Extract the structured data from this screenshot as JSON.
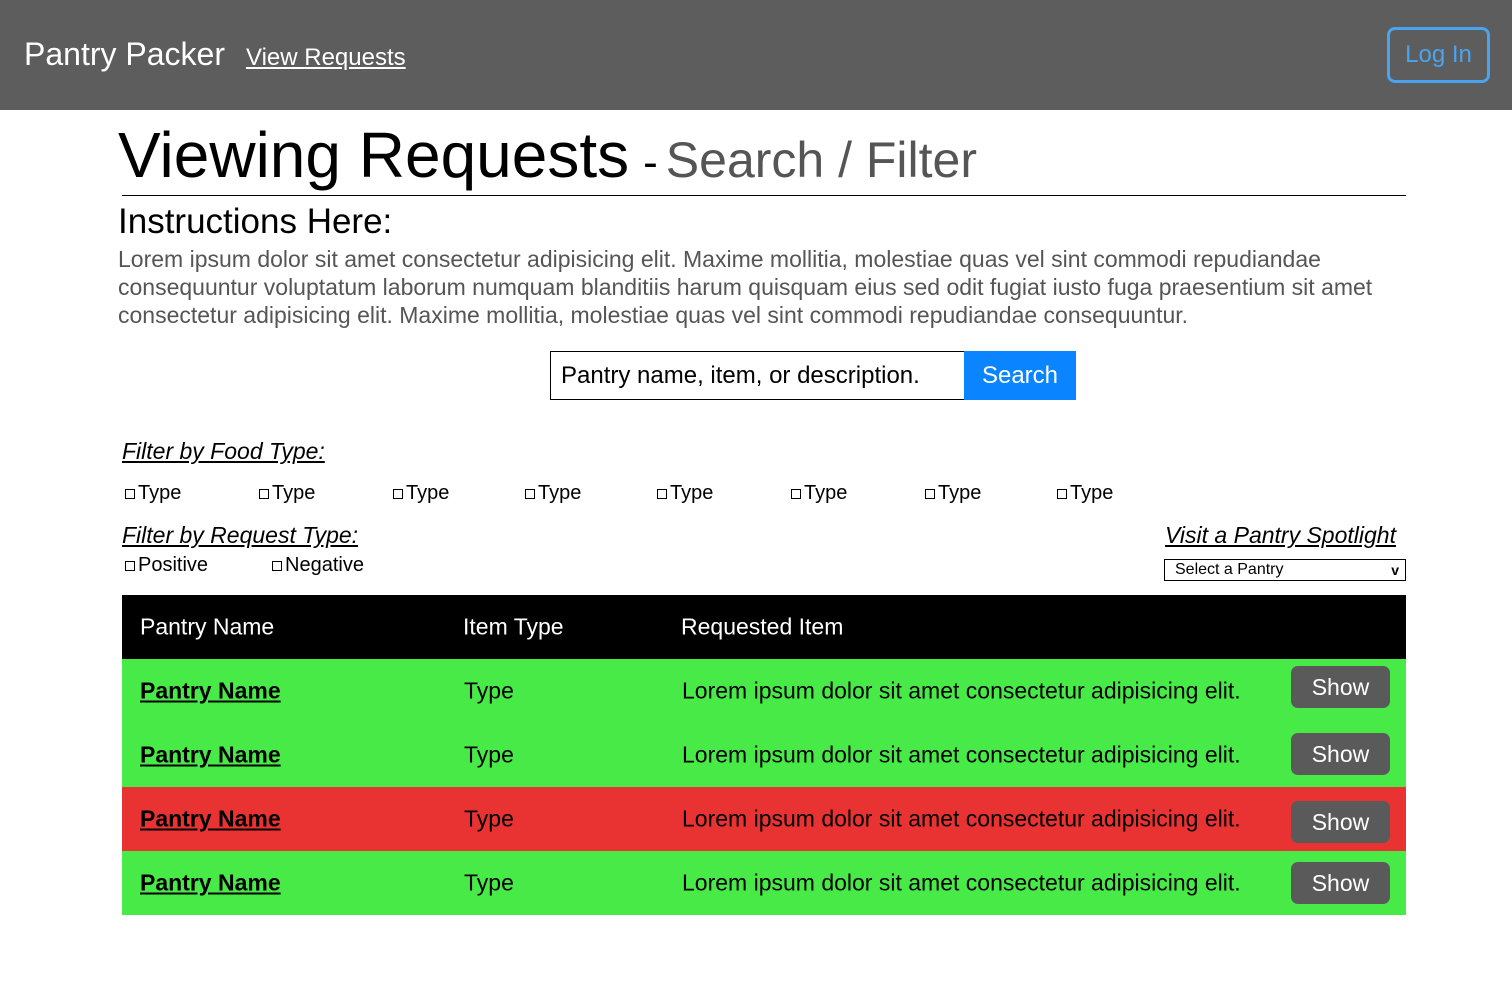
{
  "navbar": {
    "brand": "Pantry Packer",
    "view_requests": "View Requests",
    "login": "Log In",
    "login_color": "#4aa3ef"
  },
  "header": {
    "title": "Viewing Requests",
    "separator": "-",
    "subtitle": "Search / Filter"
  },
  "instructions": {
    "heading": "Instructions Here:",
    "body": "Lorem ipsum dolor sit amet consectetur adipisicing elit. Maxime mollitia, molestiae quas vel sint commodi repudiandae consequuntur voluptatum laborum numquam blanditiis harum quisquam eius sed odit fugiat iusto fuga praesentium sit amet consectetur adipisicing elit. Maxime mollitia, molestiae quas vel sint commodi repudiandae consequuntur."
  },
  "search": {
    "placeholder": "Pantry name, item, or description.",
    "button": "Search",
    "button_color": "#0a84ff"
  },
  "filters": {
    "food_type_label": "Filter by Food Type:",
    "food_types": [
      "Type",
      "Type",
      "Type",
      "Type",
      "Type",
      "Type",
      "Type",
      "Type"
    ],
    "request_type_label": "Filter by Request Type:",
    "request_types": [
      "Positive",
      "Negative"
    ]
  },
  "spotlight": {
    "label": "Visit a Pantry Spotlight",
    "selected": "Select a Pantry",
    "chevron": "v"
  },
  "table": {
    "columns": [
      "Pantry Name",
      "Item Type",
      "Requested Item"
    ],
    "rows": [
      {
        "pantry": "Pantry Name",
        "type": "Type",
        "item": "Lorem ipsum dolor sit amet consectetur adipisicing elit.",
        "action": "Show",
        "status": "positive"
      },
      {
        "pantry": "Pantry Name",
        "type": "Type",
        "item": "Lorem ipsum dolor sit amet consectetur adipisicing elit.",
        "action": "Show",
        "status": "positive"
      },
      {
        "pantry": "Pantry Name",
        "type": "Type",
        "item": "Lorem ipsum dolor sit amet consectetur adipisicing elit.",
        "action": "Show",
        "status": "negative"
      },
      {
        "pantry": "Pantry Name",
        "type": "Type",
        "item": "Lorem ipsum dolor sit amet consectetur adipisicing elit.",
        "action": "Show",
        "status": "positive"
      }
    ],
    "colors": {
      "positive": "#48ea48",
      "negative": "#e93232",
      "header": "#000000"
    }
  }
}
